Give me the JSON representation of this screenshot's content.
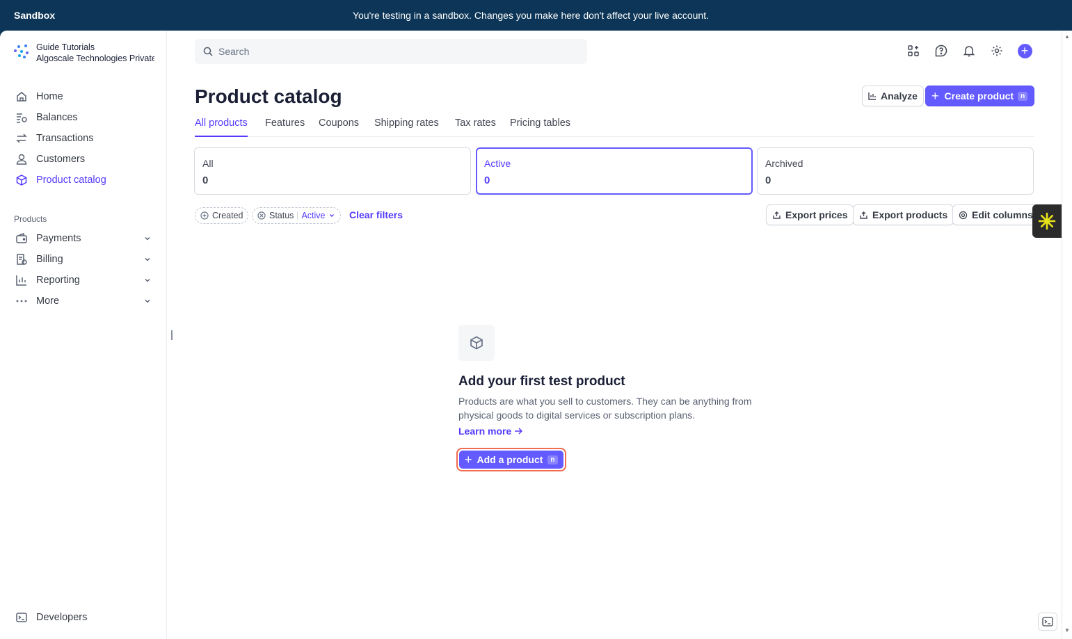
{
  "banner": {
    "label": "Sandbox",
    "message": "You're testing in a sandbox. Changes you make here don't affect your live account."
  },
  "account": {
    "name": "Guide Tutorials",
    "company": "Algoscale Technologies Private l"
  },
  "sidebar": {
    "items": [
      {
        "label": "Home",
        "icon": "home-icon"
      },
      {
        "label": "Balances",
        "icon": "balances-icon"
      },
      {
        "label": "Transactions",
        "icon": "arrows-icon"
      },
      {
        "label": "Customers",
        "icon": "person-icon"
      },
      {
        "label": "Product catalog",
        "icon": "box-icon",
        "active": true
      }
    ],
    "section_label": "Products",
    "product_items": [
      {
        "label": "Payments",
        "icon": "wallet-icon"
      },
      {
        "label": "Billing",
        "icon": "billing-icon"
      },
      {
        "label": "Reporting",
        "icon": "chart-icon"
      },
      {
        "label": "More",
        "icon": "dots-icon"
      }
    ],
    "developers": "Developers"
  },
  "search": {
    "placeholder": "Search"
  },
  "header": {
    "title": "Product catalog",
    "analyze": "Analyze",
    "create_product": "Create product",
    "shortcut": "n"
  },
  "tabs": [
    "All products",
    "Features",
    "Coupons",
    "Shipping rates",
    "Tax rates",
    "Pricing tables"
  ],
  "active_tab": "All products",
  "status_cards": [
    {
      "label": "All",
      "count": "0"
    },
    {
      "label": "Active",
      "count": "0",
      "active": true
    },
    {
      "label": "Archived",
      "count": "0"
    }
  ],
  "filters": {
    "created": "Created",
    "status": "Status",
    "status_value": "Active",
    "clear": "Clear filters"
  },
  "actions": {
    "export_prices": "Export prices",
    "export_products": "Export products",
    "edit_columns": "Edit columns"
  },
  "empty_state": {
    "title": "Add your first test product",
    "description": "Products are what you sell to customers. They can be anything from physical goods to digital services or subscription plans.",
    "learn_more": "Learn more",
    "add_button": "Add a product",
    "shortcut": "n"
  },
  "colors": {
    "accent": "#635bff",
    "banner": "#0c3557",
    "highlight": "#f26c4f"
  }
}
